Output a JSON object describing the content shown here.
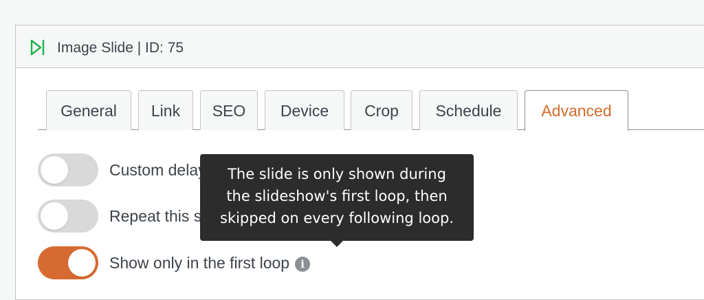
{
  "panel": {
    "title": "Image Slide | ID: 75",
    "icon": "slide-play-icon",
    "accent_color": "#20b04a"
  },
  "tabs": [
    {
      "label": "General",
      "active": false
    },
    {
      "label": "Link",
      "active": false
    },
    {
      "label": "SEO",
      "active": false
    },
    {
      "label": "Device",
      "active": false
    },
    {
      "label": "Crop",
      "active": false
    },
    {
      "label": "Schedule",
      "active": false
    },
    {
      "label": "Advanced",
      "active": true
    }
  ],
  "active_tab_color": "#d36b2b",
  "toggle_on_color": "#d76a30",
  "settings": [
    {
      "label": "Custom delay for this slide",
      "enabled": false,
      "info_icon": "info-icon"
    },
    {
      "label": "Repeat this slide",
      "enabled": false,
      "info_icon": "info-icon"
    },
    {
      "label": "Show only in the first loop",
      "enabled": true,
      "info_icon": "info-icon"
    }
  ],
  "tooltip": {
    "lines": [
      "The slide is only shown during",
      "the slideshow's first loop, then",
      "skipped on every following loop."
    ]
  }
}
